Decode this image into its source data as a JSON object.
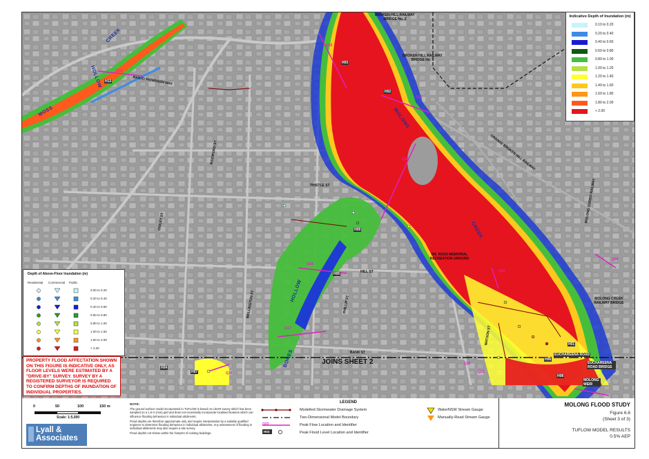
{
  "map": {
    "streets": [
      "BANJO PATERSON WAY",
      "THISTLE ST",
      "HILL ST",
      "BANK ST",
      "RIDDIFORD ST",
      "PHILLIP ST",
      "GIDLEY ST",
      "WELLINGTON ST",
      "WATSON ST",
      "EUCHAREENA ROAD",
      "ORANGE BROKEN HILL RAILWAY",
      "MOLONG DUBBO RAILWAY"
    ],
    "waterways": [
      "MOSS",
      "HOLLOW",
      "CREEK",
      "MOLONG",
      "CREEK",
      "HOLLOW",
      "BORES"
    ],
    "places": [
      "BROKEN HILL RAILWAY BRIDGE No. 2",
      "BROKEN HILL RAILWAY BRIDGE No. 1",
      "DR. ROSS MEMORIAL RECREATION GROUND",
      "MOLONG CREEK RAILWAY BRIDGE",
      "EUCHAREENA ROAD BRIDGE",
      "MOLONG WEIR"
    ],
    "gauges": [
      "H13",
      "H03",
      "H02",
      "H09",
      "H05",
      "H07",
      "H04",
      "H01",
      "H06",
      "H08"
    ],
    "flow_lines": [
      "Q13",
      "Q15",
      "Q16",
      "Q14",
      "Q17",
      "Q18",
      "Q19",
      "Q20",
      "Q21",
      "Q22",
      "Q04"
    ],
    "joins_label": "JOINS SHEET 2"
  },
  "legend_inundation": {
    "title": "Indicative Depth of Inundation (m)",
    "classes": [
      {
        "label": "0.10 to 0.20",
        "color": "#c8f4f8"
      },
      {
        "label": "0.20 to 0.40",
        "color": "#3c8ce6"
      },
      {
        "label": "0.40 to 0.60",
        "color": "#1a1ad2"
      },
      {
        "label": "0.60 to 0.80",
        "color": "#0e5a14"
      },
      {
        "label": "0.80 to 1.00",
        "color": "#46be3c"
      },
      {
        "label": "1.00 to 1.20",
        "color": "#b4e046"
      },
      {
        "label": "1.20 to 1.40",
        "color": "#ffff32"
      },
      {
        "label": "1.40 to 1.60",
        "color": "#ffc81e"
      },
      {
        "label": "1.60 to 1.80",
        "color": "#ff9614"
      },
      {
        "label": "1.80 to 2.00",
        "color": "#ff5a1e"
      },
      {
        "label": "> 2.00",
        "color": "#e6141e"
      }
    ]
  },
  "legend_floor": {
    "title": "Depth of Above-Floor Inundation (m)",
    "headers": [
      "Residential",
      "Commercial",
      "Public"
    ],
    "classes": [
      {
        "label": "0.00 to 0.20",
        "color": "#c8f4f8"
      },
      {
        "label": "0.20 to 0.40",
        "color": "#3c8ce6"
      },
      {
        "label": "0.40 to 0.60",
        "color": "#1a1ad2"
      },
      {
        "label": "0.60 to 0.80",
        "color": "#2a9a2a"
      },
      {
        "label": "0.80 to 1.00",
        "color": "#b4e046"
      },
      {
        "label": "1.00 to 1.50",
        "color": "#ffff32"
      },
      {
        "label": "1.50 to 2.00",
        "color": "#ff9614"
      },
      {
        "label": "> 2.00",
        "color": "#e6141e"
      }
    ]
  },
  "warning": "PROPERTY FLOOD AFFECTATION SHOWN ON THIS FIGURE IS INDICATIVE ONLY, AS FLOOR LEVELS WERE ESTIMATED BY A \"DRIVE-BY\" SURVEY. SURVEY BY A REGISTERED SURVEYOR IS REQUIRED TO CONFIRM DEPTHS OF INUNDATION OF INDIVIDUAL PROPERTIES.",
  "scale": {
    "ticks": [
      "0",
      "50",
      "100",
      "150 m"
    ],
    "zero_left": "",
    "text": "Scale: 1:5,000"
  },
  "brand": "Lyall & Associates",
  "notes": {
    "heading": "NOTE:",
    "items": [
      "The ground surface model incorporated in TUFLOW is based on LiDAR survey which has been sampled on a 1.5 m (min) grid and does not necessarily incorporate localised features which can influence flooding behaviour in individual allotments.",
      "Flood depths are therefore approximate only and require interpretation by a suitably qualified engineer to determine flooding behaviour in individual allotments. Any assessment of flooding in individual allotments may also require a site survey.",
      "Flood depths not shown within the footprint of existing buildings."
    ]
  },
  "legend": {
    "title": "LEGEND",
    "items": [
      "Modelled Stormwater Drainage System",
      "Two-Dimensional Model Boundary",
      "Peak Flow Location and Identifier",
      "Peak Flood Level Location and Identifier",
      "WaterNSW Stream Gauge",
      "Manually-Read Stream Gauge"
    ],
    "flow_id": "Q22",
    "level_id": "H03"
  },
  "title_block": {
    "study": "MOLONG FLOOD STUDY",
    "figure": "Figure 6.6",
    "sheet": "(Sheet 3 of 3)",
    "results": "TUFLOW MODEL RESULTS",
    "aep": "0.5% AEP"
  }
}
